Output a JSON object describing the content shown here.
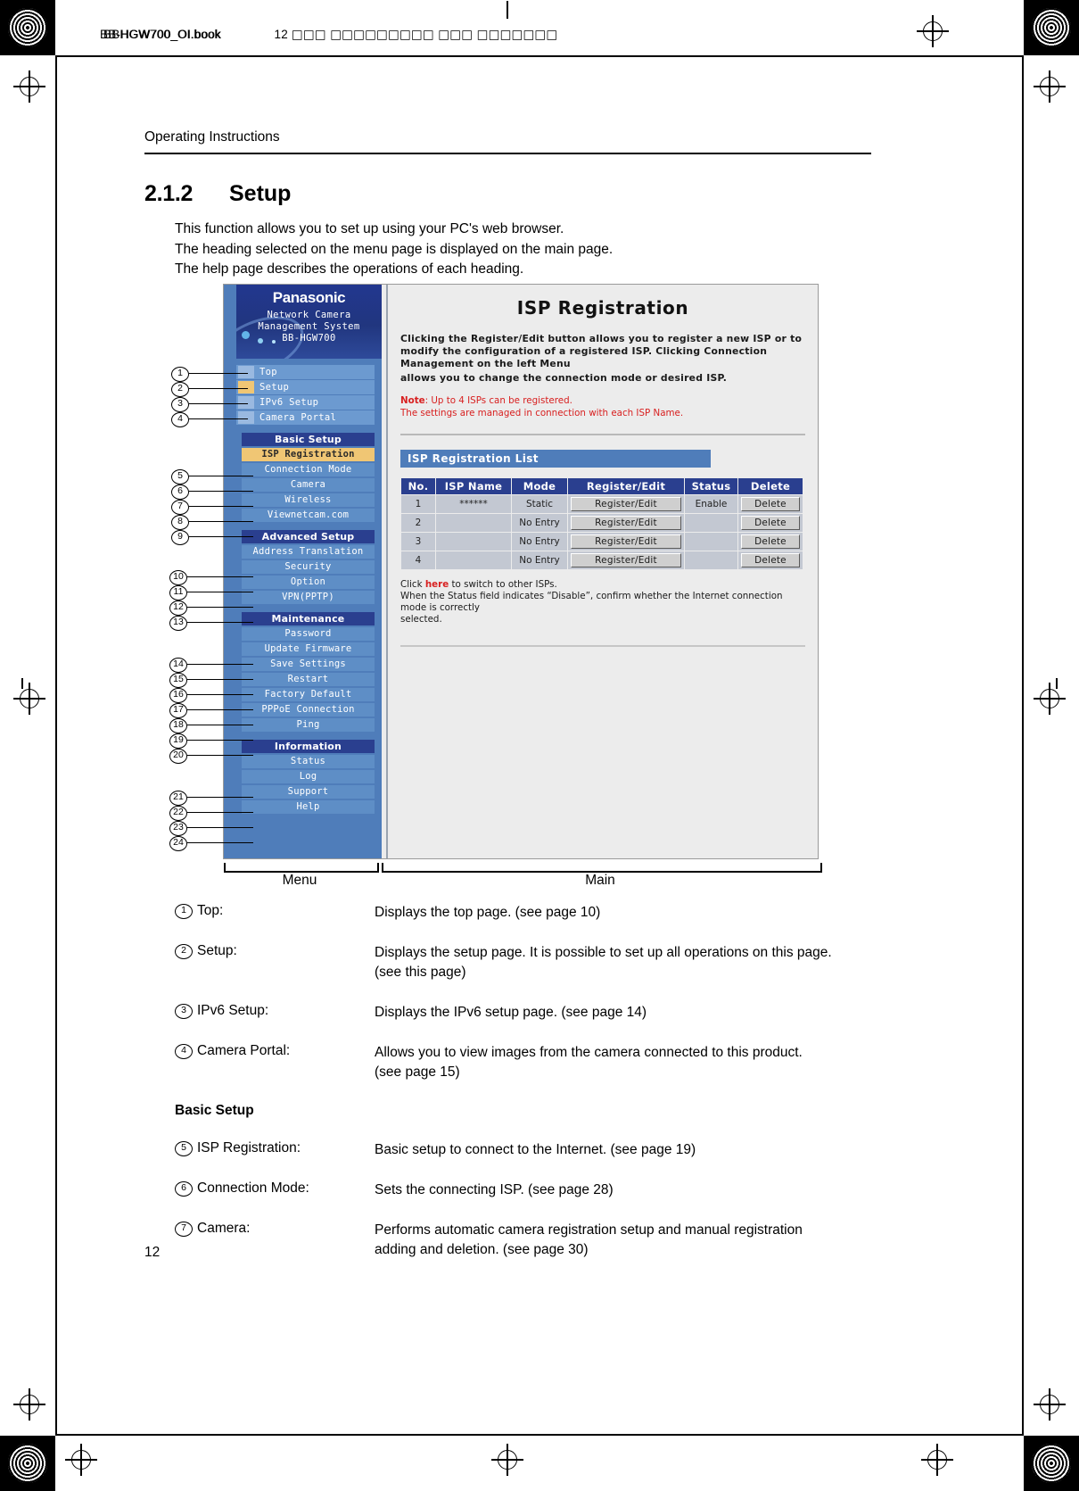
{
  "print_header": {
    "file_line_a": "BB-HGW700_OI.book",
    "file_line_b": "BBHGW700_OI.book",
    "page_marker": "12",
    "cjk_run": "□□□ □□□□□□□□□ □□□ □□□□□□□"
  },
  "running_header": "Operating Instructions",
  "section": {
    "number": "2.1.2",
    "title": "Setup",
    "intro_lines": [
      "This function allows you to set up using your PC's web browser.",
      "The heading selected on the menu page is displayed on the main page.",
      "The help page describes the operations of each heading."
    ]
  },
  "screenshot": {
    "brand": "Panasonic",
    "brand_sub_line1": "Network Camera",
    "brand_sub_line2": "Management System",
    "model": "BB-HGW700",
    "top_nav": [
      {
        "label": "Top",
        "selected": false
      },
      {
        "label": "Setup",
        "selected": true
      },
      {
        "label": "IPv6 Setup",
        "selected": false
      },
      {
        "label": "Camera Portal",
        "selected": false
      }
    ],
    "groups": [
      {
        "heading": "Basic Setup",
        "items": [
          {
            "label": "ISP Registration",
            "highlighted": true
          },
          {
            "label": "Connection Mode",
            "highlighted": false
          },
          {
            "label": "Camera",
            "highlighted": false
          },
          {
            "label": "Wireless",
            "highlighted": false
          },
          {
            "label": "Viewnetcam.com",
            "highlighted": false
          }
        ]
      },
      {
        "heading": "Advanced Setup",
        "items": [
          {
            "label": "Address Translation",
            "highlighted": false
          },
          {
            "label": "Security",
            "highlighted": false
          },
          {
            "label": "Option",
            "highlighted": false
          },
          {
            "label": "VPN(PPTP)",
            "highlighted": false
          }
        ]
      },
      {
        "heading": "Maintenance",
        "items": [
          {
            "label": "Password",
            "highlighted": false
          },
          {
            "label": "Update Firmware",
            "highlighted": false
          },
          {
            "label": "Save Settings",
            "highlighted": false
          },
          {
            "label": "Restart",
            "highlighted": false
          },
          {
            "label": "Factory Default",
            "highlighted": false
          },
          {
            "label": "PPPoE Connection",
            "highlighted": false
          },
          {
            "label": "Ping",
            "highlighted": false
          }
        ]
      },
      {
        "heading": "Information",
        "items": [
          {
            "label": "Status",
            "highlighted": false
          },
          {
            "label": "Log",
            "highlighted": false
          },
          {
            "label": "Support",
            "highlighted": false
          },
          {
            "label": "Help",
            "highlighted": false
          }
        ]
      }
    ],
    "main": {
      "title": "ISP Registration",
      "description": "Clicking the Register/Edit button allows you to register a new ISP or to modify the configuration of a registered ISP. Clicking Connection Management on the left Menu",
      "description_line2": "allows you to change the connection mode or desired ISP.",
      "note_label": "Note",
      "note_line1": ": Up to 4 ISPs can be registered.",
      "note_line2": "The settings are managed in connection with each ISP Name.",
      "list_title": "ISP Registration List",
      "table": {
        "headers": [
          "No.",
          "ISP Name",
          "Mode",
          "Register/Edit",
          "Status",
          "Delete"
        ],
        "rows": [
          {
            "no": "1",
            "isp_name": "******",
            "mode": "Static",
            "register": "Register/Edit",
            "status": "Enable",
            "delete": "Delete"
          },
          {
            "no": "2",
            "isp_name": "",
            "mode": "No Entry",
            "register": "Register/Edit",
            "status": "",
            "delete": "Delete"
          },
          {
            "no": "3",
            "isp_name": "",
            "mode": "No Entry",
            "register": "Register/Edit",
            "status": "",
            "delete": "Delete"
          },
          {
            "no": "4",
            "isp_name": "",
            "mode": "No Entry",
            "register": "Register/Edit",
            "status": "",
            "delete": "Delete"
          }
        ]
      },
      "footer_pre": "Click ",
      "footer_link": "here",
      "footer_post": " to switch to other ISPs.",
      "footer_line2": "When the Status field indicates “Disable”, confirm whether the Internet connection mode is correctly",
      "footer_line3": "selected."
    }
  },
  "braces": {
    "menu_label": "Menu",
    "main_label": "Main"
  },
  "callouts": [
    "1",
    "2",
    "3",
    "4",
    "5",
    "6",
    "7",
    "8",
    "9",
    "10",
    "11",
    "12",
    "13",
    "14",
    "15",
    "16",
    "17",
    "18",
    "19",
    "20",
    "21",
    "22",
    "23",
    "24"
  ],
  "legend": {
    "entries": [
      {
        "num": "1",
        "term": "Top:",
        "desc": "Displays the top page. (see page 10)"
      },
      {
        "num": "2",
        "term": "Setup:",
        "desc": "Displays the setup page. It is possible to set up all operations on this page. (see this page)"
      },
      {
        "num": "3",
        "term": "IPv6 Setup:",
        "desc": "Displays the IPv6 setup page. (see page 14)"
      },
      {
        "num": "4",
        "term": "Camera Portal:",
        "desc": "Allows you to view images from the camera connected to this product. (see page 15)"
      }
    ],
    "subheading": "Basic Setup",
    "entries2": [
      {
        "num": "5",
        "term": "ISP Registration:",
        "desc": "Basic setup to connect to the Internet. (see page 19)"
      },
      {
        "num": "6",
        "term": "Connection Mode:",
        "desc": "Sets the connecting ISP. (see page 28)"
      },
      {
        "num": "7",
        "term": "Camera:",
        "desc": "Performs automatic camera registration setup and manual registration adding and deletion. (see page 30)"
      }
    ]
  },
  "page_number": "12"
}
